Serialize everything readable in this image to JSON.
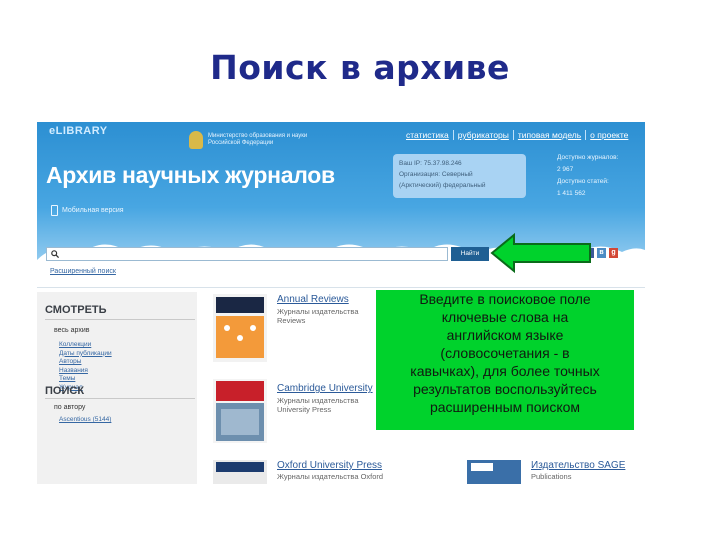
{
  "slide": {
    "title": "Поиск в архиве"
  },
  "site": {
    "logo": "eLIBRARY",
    "ministry": "Министерство образования и науки Российской Федерации",
    "nav": [
      "статистика",
      "рубрикаторы",
      "типовая модель",
      "о проекте"
    ],
    "title": "Архив научных журналов",
    "ip_box": [
      "Ваш IP: 75.37.98.246",
      "Организация: Северный",
      "(Арктический) федеральный"
    ],
    "stats": [
      "Доступно журналов:",
      "2 967",
      "Доступно статей:",
      "1 411 562"
    ],
    "mobile_link": "Мобильная версия",
    "search": {
      "value": "",
      "button": "Найти"
    },
    "advanced_search": "Расширенный поиск"
  },
  "sidebar": {
    "view_heading": "СМОТРЕТЬ",
    "view_sub": "весь архив",
    "view_links": [
      "Коллекции",
      "Даты публикации",
      "Авторы",
      "Названия",
      "Темы",
      "Журнал"
    ],
    "search_heading": "ПОИСК",
    "search_sub": "по автору",
    "author_link": "Ascentious (5144)"
  },
  "publishers": [
    {
      "name": "Annual Reviews",
      "sub": [
        "Журналы издательства",
        "Reviews"
      ]
    },
    {
      "name": "Cambridge University",
      "sub": [
        "Журналы издательства",
        "University Press"
      ]
    },
    {
      "name": "Oxford University Press",
      "sub": [
        "Журналы издательства Oxford"
      ]
    },
    {
      "name": "Издательство SAGE",
      "sub": [
        "Publications"
      ]
    }
  ],
  "callout": {
    "lines": [
      "Введите в поисковое поле",
      "ключевые слова на",
      "английском языке",
      "(словосочетания - в",
      "кавычках), для более точных",
      "результатов воспользуйтесь",
      "расширенным поиском"
    ]
  },
  "colors": {
    "header_blue": "#2c8fd2",
    "title_navy": "#1f2a8a",
    "callout_green": "#00d22c",
    "button_blue": "#1f5f93"
  },
  "icons": [
    "search-icon",
    "mobile-icon",
    "arrow-icon",
    "social-icons"
  ]
}
